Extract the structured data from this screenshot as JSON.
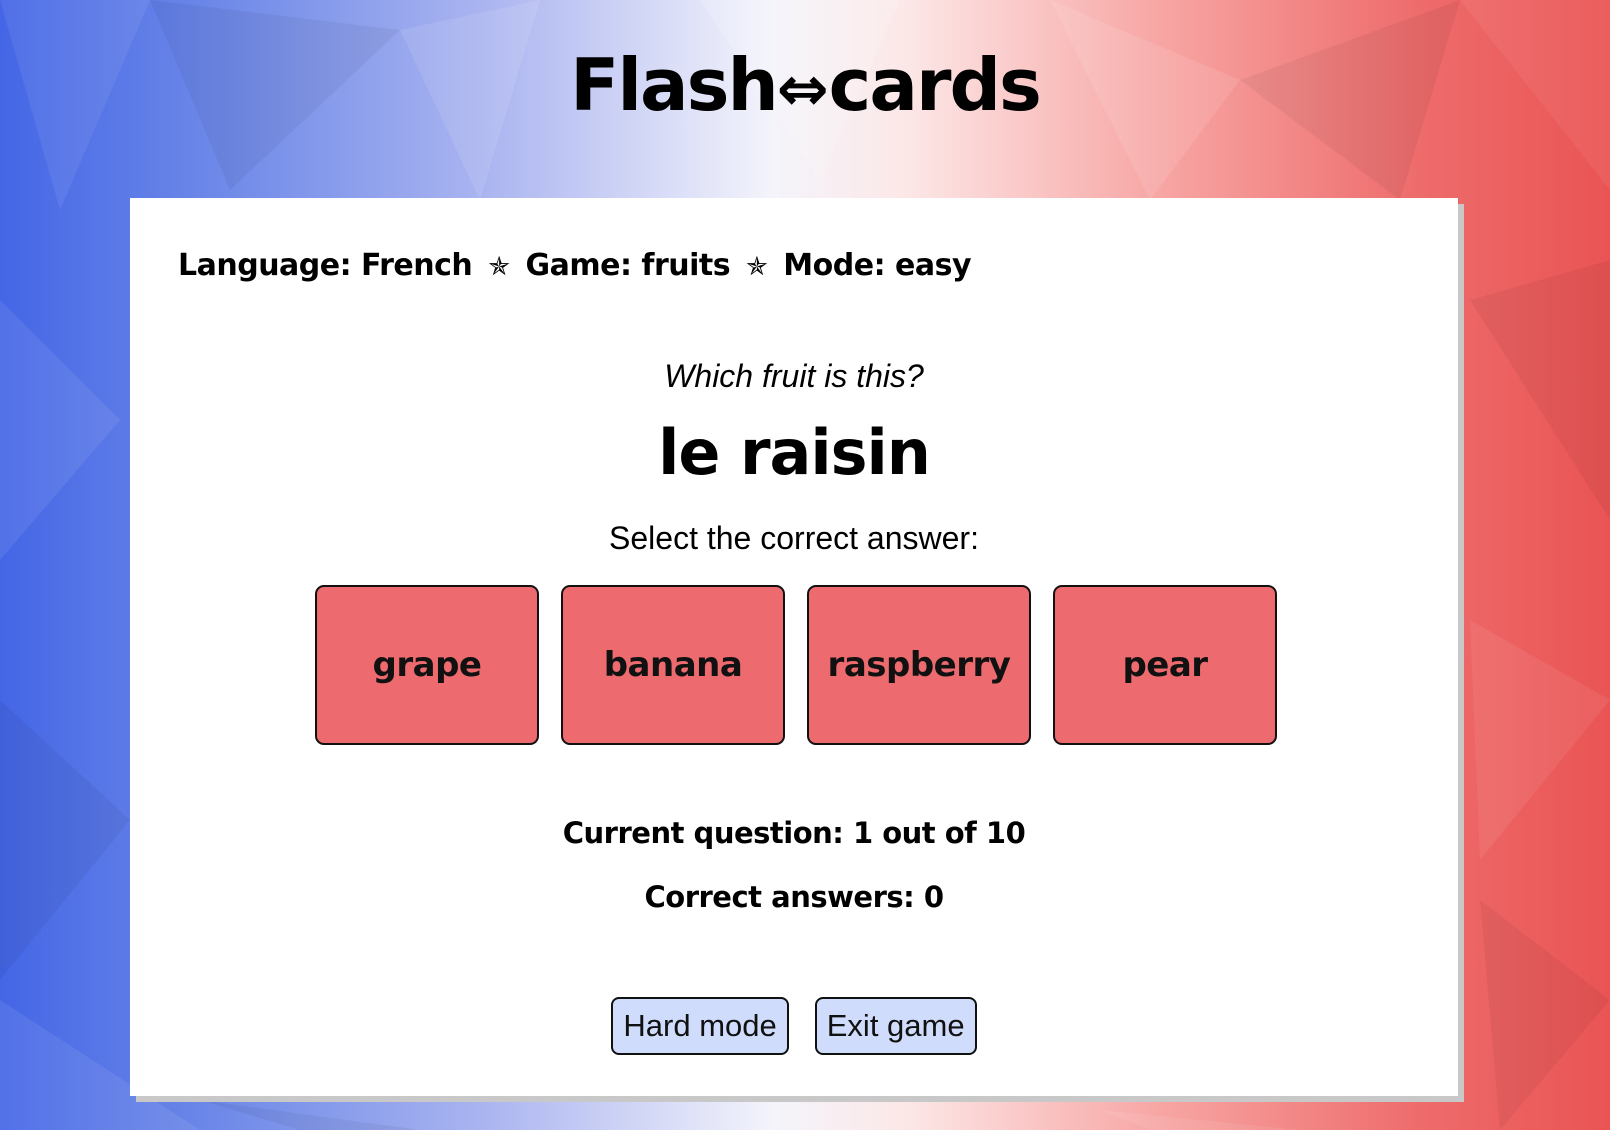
{
  "header": {
    "logo_left": "Flash",
    "logo_arrows": "⇔",
    "logo_right": "cards"
  },
  "meta": {
    "language": "Language: French",
    "game": "Game: fruits",
    "mode": "Mode: easy",
    "separator": "✯"
  },
  "question": {
    "prompt": "Which fruit is this?",
    "word": "le raisin",
    "instruction": "Select the correct answer:"
  },
  "answers": [
    {
      "label": "grape"
    },
    {
      "label": "banana"
    },
    {
      "label": "raspberry"
    },
    {
      "label": "pear"
    }
  ],
  "status": {
    "current_question": "Current question: 1 out of 10",
    "correct_answers": "Correct answers: 0"
  },
  "controls": {
    "hard_mode": "Hard mode",
    "exit_game": "Exit game"
  },
  "colors": {
    "answer_button": "#ed6a6e",
    "control_button": "#cfdcfb",
    "card": "#ffffff",
    "flag_blue": "#4466e6",
    "flag_red": "#ea5454"
  }
}
